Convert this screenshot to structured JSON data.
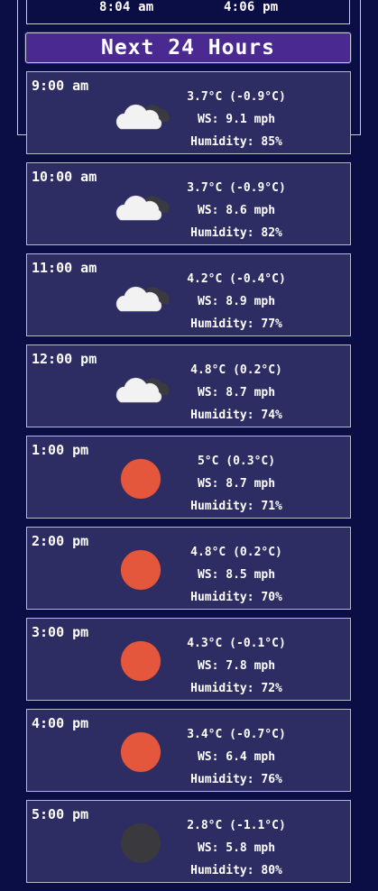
{
  "sun": {
    "sunrise": "8:04 am",
    "sunset": "4:06 pm"
  },
  "section_title": "Next 24 Hours",
  "hours": [
    {
      "time": "9:00 am",
      "temp": "3.7°C (-0.9°C)",
      "ws": "WS: 9.1 mph",
      "humidity": "Humidity: 85%",
      "icon": "partly-cloudy-icon"
    },
    {
      "time": "10:00 am",
      "temp": "3.7°C (-0.9°C)",
      "ws": "WS: 8.6 mph",
      "humidity": "Humidity: 82%",
      "icon": "partly-cloudy-icon"
    },
    {
      "time": "11:00 am",
      "temp": "4.2°C (-0.4°C)",
      "ws": "WS: 8.9 mph",
      "humidity": "Humidity: 77%",
      "icon": "partly-cloudy-icon"
    },
    {
      "time": "12:00 pm",
      "temp": "4.8°C (0.2°C)",
      "ws": "WS: 8.7 mph",
      "humidity": "Humidity: 74%",
      "icon": "partly-cloudy-icon"
    },
    {
      "time": "1:00 pm",
      "temp": "5°C (0.3°C)",
      "ws": "WS: 8.7 mph",
      "humidity": "Humidity: 71%",
      "icon": "sun-icon"
    },
    {
      "time": "2:00 pm",
      "temp": "4.8°C (0.2°C)",
      "ws": "WS: 8.5 mph",
      "humidity": "Humidity: 70%",
      "icon": "sun-icon"
    },
    {
      "time": "3:00 pm",
      "temp": "4.3°C (-0.1°C)",
      "ws": "WS: 7.8 mph",
      "humidity": "Humidity: 72%",
      "icon": "sun-icon"
    },
    {
      "time": "4:00 pm",
      "temp": "3.4°C (-0.7°C)",
      "ws": "WS: 6.4 mph",
      "humidity": "Humidity: 76%",
      "icon": "sun-icon"
    },
    {
      "time": "5:00 pm",
      "temp": "2.8°C (-1.1°C)",
      "ws": "WS: 5.8 mph",
      "humidity": "Humidity: 80%",
      "icon": "moon-icon"
    }
  ],
  "colors": {
    "background": "#0b0d45",
    "card": "#2d2c63",
    "header": "#4a2a90",
    "sun": "#e4573d",
    "moon": "#3a3a3e",
    "cloud": "#f2f2f2",
    "cloud_dark": "#3a3a40"
  }
}
